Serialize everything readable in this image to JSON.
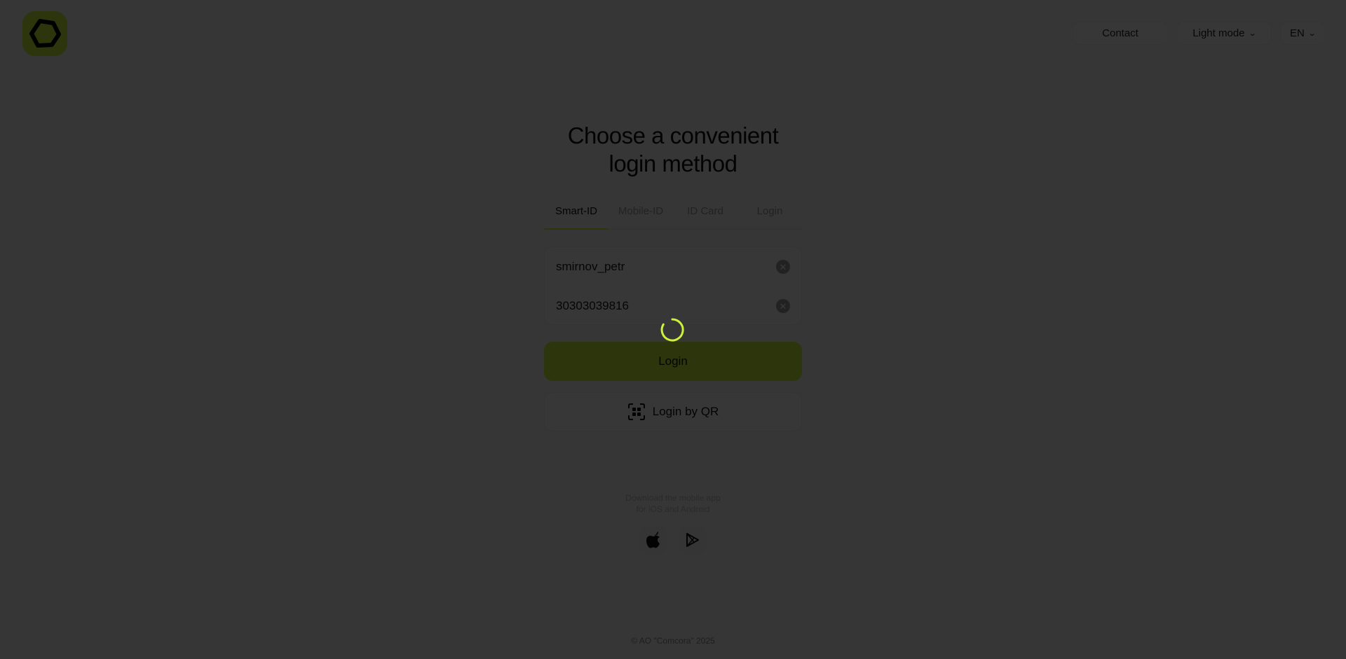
{
  "header": {
    "contact_label": "Contact",
    "mode_label": "Light mode",
    "lang_label": "EN"
  },
  "title": "Choose a convenient login method",
  "tabs": [
    {
      "label": "Smart-ID",
      "active": true
    },
    {
      "label": "Mobile-ID",
      "active": false
    },
    {
      "label": "ID Card",
      "active": false
    },
    {
      "label": "Login",
      "active": false
    }
  ],
  "form": {
    "username_value": "smirnov_petr",
    "id_value": "30303039816"
  },
  "buttons": {
    "login_label": "Login",
    "qr_label": "Login by QR"
  },
  "apps": {
    "text": "Download the mobile app for iOS and Android"
  },
  "footer": {
    "copyright": "© AO \"Comcora\" 2025"
  },
  "colors": {
    "accent": "#cdf23a",
    "overlay": "#000000"
  },
  "icons": {
    "logo": "hexagon-logo",
    "clear": "clear-icon",
    "qr": "qr-scan-icon",
    "apple": "apple-icon",
    "google_play": "google-play-icon",
    "spinner": "loading-spinner"
  }
}
